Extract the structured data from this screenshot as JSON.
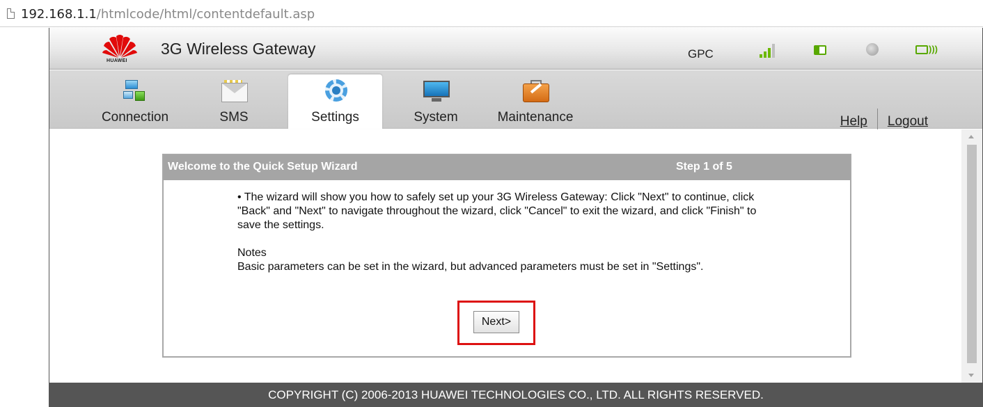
{
  "browser": {
    "url_host": "192.168.1.1",
    "url_path": "/htmlcode/html/contentdefault.asp"
  },
  "header": {
    "brand": "HUAWEI",
    "title": "3G Wireless Gateway",
    "operator": "GPC",
    "status_icons": [
      "signal-strength-icon",
      "battery-icon",
      "globe-icon",
      "wifi-icon"
    ],
    "signal_bars_active": 3,
    "signal_bars_total": 4,
    "accent_color": "#6cb800"
  },
  "nav": {
    "tabs": [
      {
        "label": "Connection",
        "icon": "connection-icon"
      },
      {
        "label": "SMS",
        "icon": "sms-envelope-icon"
      },
      {
        "label": "Settings",
        "icon": "settings-gear-icon"
      },
      {
        "label": "System",
        "icon": "system-monitor-icon"
      },
      {
        "label": "Maintenance",
        "icon": "maintenance-toolbox-icon"
      }
    ],
    "active_tab": "Settings",
    "help": "Help",
    "logout": "Logout"
  },
  "wizard": {
    "title": "Welcome to the Quick Setup Wizard",
    "step": "Step 1 of 5",
    "intro": "• The wizard will show you how to safely set up your 3G Wireless Gateway: Click \"Next\" to continue, click \"Back\" and \"Next\" to navigate throughout the wizard, click \"Cancel\" to exit the wizard, and click \"Finish\" to save the settings.",
    "notes_heading": "Notes",
    "notes_text": "Basic parameters can be set in the wizard, but advanced parameters must be set in \"Settings\".",
    "next_label": "Next>",
    "highlight_color": "#dd1111"
  },
  "footer": {
    "copyright": "COPYRIGHT (C) 2006-2013 HUAWEI TECHNOLOGIES CO., LTD. ALL RIGHTS RESERVED."
  }
}
